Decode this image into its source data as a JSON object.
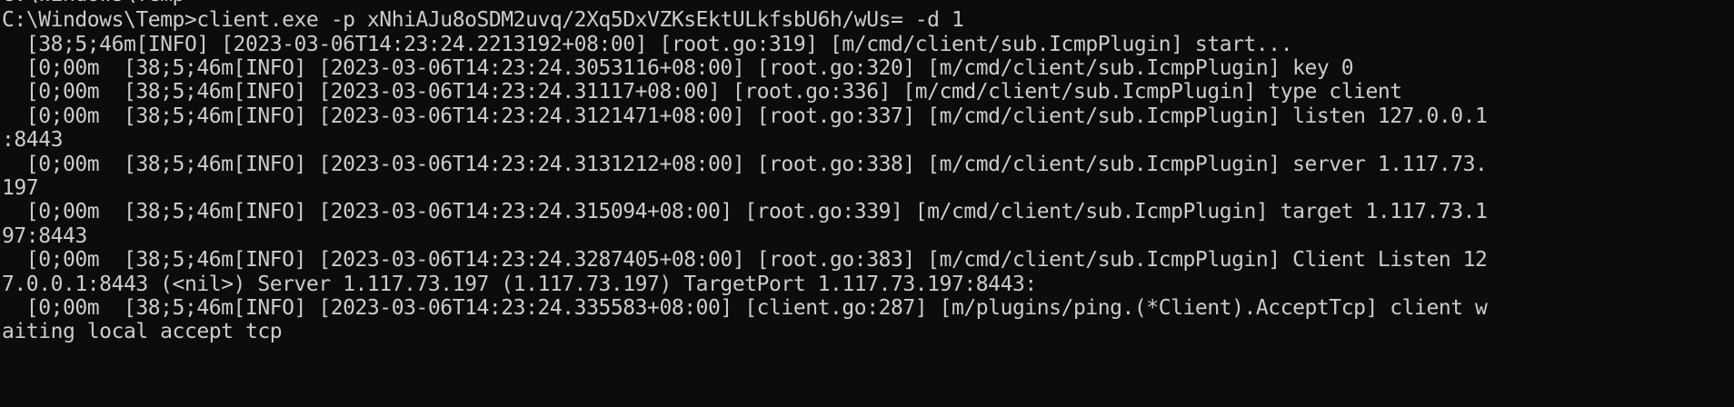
{
  "console": {
    "lines": [
      "C:\\Windows\\Temp>",
      "C:\\Windows\\Temp>client.exe -p xNhiAJu8oSDM2uvq/2Xq5DxVZKsEktULkfsbU6h/wUs= -d 1",
      "  [38;5;46m[INFO] [2023-03-06T14:23:24.2213192+08:00] [root.go:319] [m/cmd/client/sub.IcmpPlugin] start...",
      "  [0;00m  [38;5;46m[INFO] [2023-03-06T14:23:24.3053116+08:00] [root.go:320] [m/cmd/client/sub.IcmpPlugin] key 0",
      "  [0;00m  [38;5;46m[INFO] [2023-03-06T14:23:24.31117+08:00] [root.go:336] [m/cmd/client/sub.IcmpPlugin] type client",
      "  [0;00m  [38;5;46m[INFO] [2023-03-06T14:23:24.3121471+08:00] [root.go:337] [m/cmd/client/sub.IcmpPlugin] listen 127.0.0.1",
      ":8443",
      "  [0;00m  [38;5;46m[INFO] [2023-03-06T14:23:24.3131212+08:00] [root.go:338] [m/cmd/client/sub.IcmpPlugin] server 1.117.73.",
      "197",
      "  [0;00m  [38;5;46m[INFO] [2023-03-06T14:23:24.315094+08:00] [root.go:339] [m/cmd/client/sub.IcmpPlugin] target 1.117.73.1",
      "97:8443",
      "  [0;00m  [38;5;46m[INFO] [2023-03-06T14:23:24.3287405+08:00] [root.go:383] [m/cmd/client/sub.IcmpPlugin] Client Listen 12",
      "7.0.0.1:8443 (<nil>) Server 1.117.73.197 (1.117.73.197) TargetPort 1.117.73.197:8443:",
      "  [0;00m  [38;5;46m[INFO] [2023-03-06T14:23:24.335583+08:00] [client.go:287] [m/plugins/ping.(*Client).AcceptTcp] client w",
      "aiting local accept tcp"
    ]
  }
}
